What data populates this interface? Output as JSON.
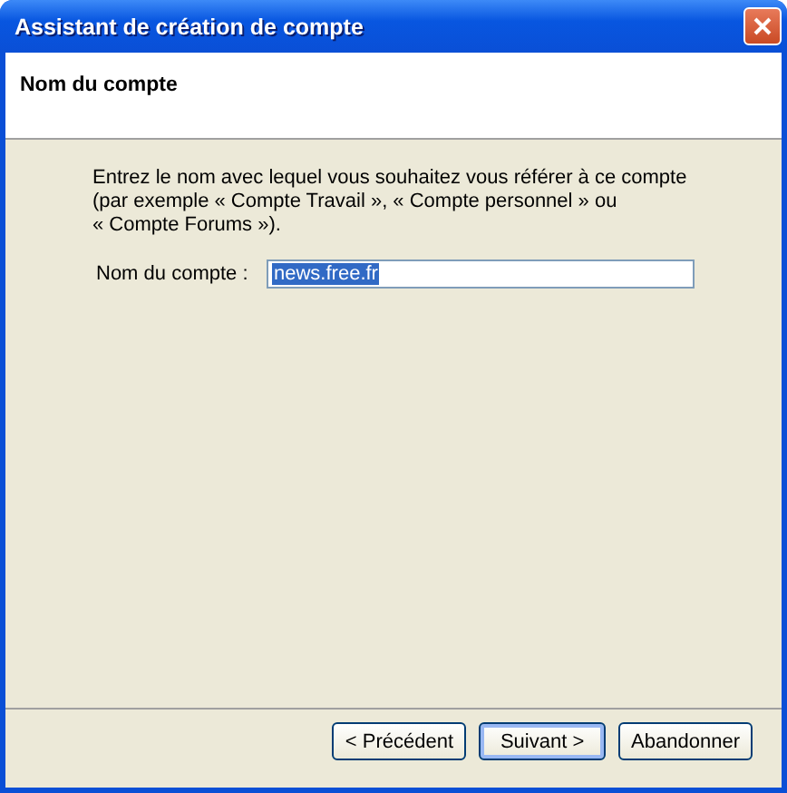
{
  "window": {
    "title": "Assistant de création de compte"
  },
  "header": {
    "title": "Nom du compte"
  },
  "description": [
    "Entrez le nom avec lequel vous souhaitez vous référer à ce compte",
    "(par exemple « Compte Travail », « Compte personnel » ou",
    "« Compte Forums »)."
  ],
  "account_name": {
    "label": "Nom du compte :",
    "value": "news.free.fr",
    "text_selected": true
  },
  "buttons": [
    {
      "label": "< Précédent",
      "default": false
    },
    {
      "label": "Suivant >",
      "default": true
    },
    {
      "label": "Abandonner",
      "default": false
    }
  ]
}
